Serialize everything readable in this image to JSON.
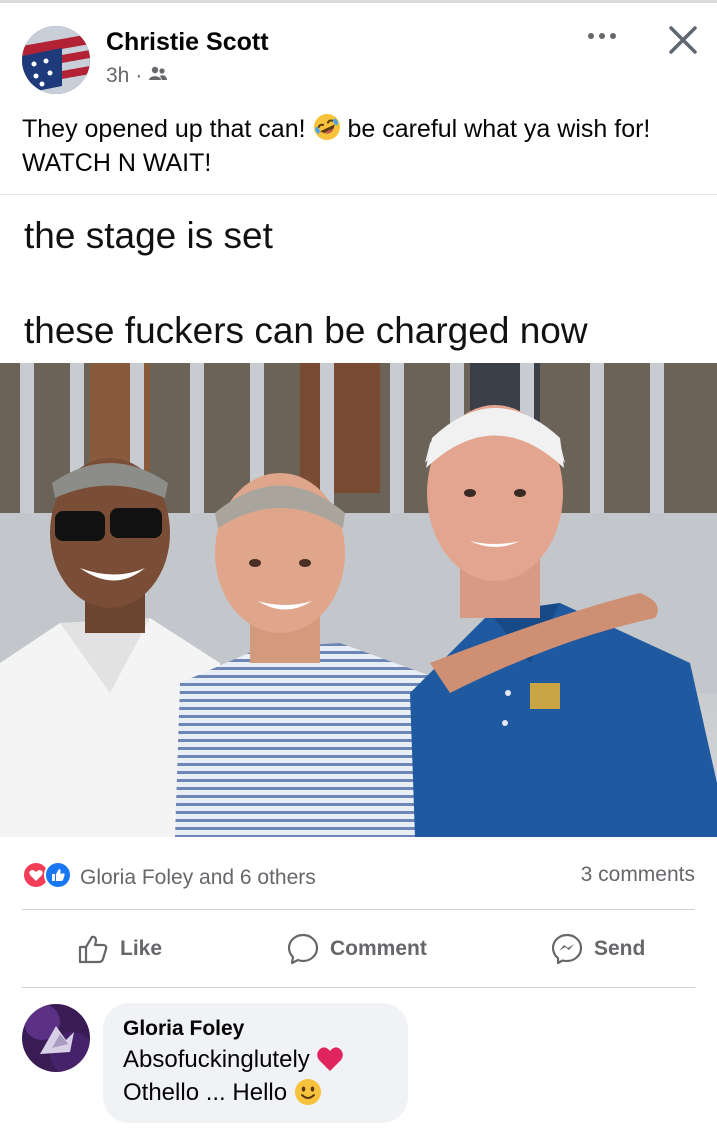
{
  "post": {
    "author": "Christie Scott",
    "time": "3h",
    "audience_icon": "friends-icon",
    "caption_part1": "They opened up that can! ",
    "caption_emoji": "rolling-on-floor-laughing-emoji",
    "caption_part2": " be careful what ya wish for! WATCH N WAIT!",
    "menu_icon": "more-icon",
    "close_icon": "close-icon"
  },
  "meme": {
    "line1": "the stage is set",
    "line2": "these fuckers can be charged now",
    "photo_description_icon": "photo"
  },
  "reactions": {
    "icons": [
      "love-reaction-icon",
      "like-reaction-icon"
    ],
    "summary": "Gloria Foley and 6 others",
    "comments": "3 comments"
  },
  "actions": {
    "like": "Like",
    "comment": "Comment",
    "send": "Send"
  },
  "comment": {
    "author": "Gloria Foley",
    "line1": "Absofuckinglutely ",
    "line2": "Othello ... Hello "
  },
  "colors": {
    "secondary_text": "#65676b",
    "like_blue": "#1877f2",
    "love_red": "#f33e58",
    "bubble_bg": "#f0f2f5"
  }
}
